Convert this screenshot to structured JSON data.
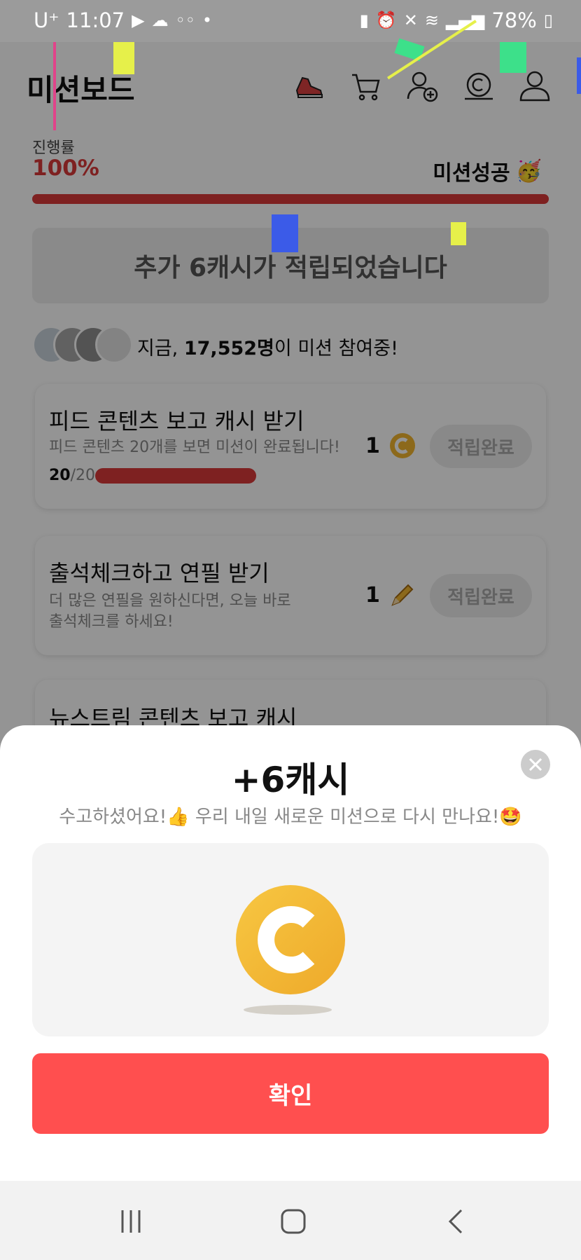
{
  "status_bar": {
    "carrier": "U⁺",
    "time": "11:07",
    "battery": "78%"
  },
  "header": {
    "title": "미션보드",
    "icons": [
      "shoe-icon",
      "cart-icon",
      "add-user-icon",
      "cash-icon",
      "profile-icon"
    ]
  },
  "progress": {
    "label": "진행률",
    "value_text": "100%",
    "value": 1.0,
    "status": "미션성공",
    "status_emoji": "🥳"
  },
  "notice": {
    "text": "추가 6캐시가 적립되었습니다"
  },
  "participants": {
    "prefix": "지금, ",
    "count": "17,552명",
    "suffix": "이 미션 참여중!"
  },
  "missions": [
    {
      "title": "피드 콘텐츠 보고 캐시 받기",
      "desc": "피드 콘텐츠 20개를 보면 미션이 완료됩니다!",
      "current": "20",
      "total": "/20",
      "progress": 1.0,
      "reward_amount": "1",
      "reward_icon": "coin-icon",
      "button": "적립완료"
    },
    {
      "title": "출석체크하고 연필 받기",
      "desc_line1": "더 많은 연필을 원하신다면, 오늘 바로",
      "desc_line2": "출석체크를 하세요!",
      "reward_amount": "1",
      "reward_icon": "pencil-icon",
      "button": "적립완료"
    },
    {
      "title": "뉴스트림 콘텐츠 보고 캐시"
    }
  ],
  "modal": {
    "title": "+6캐시",
    "message": "수고하셨어요!👍 우리 내일 새로운 미션으로 다시 만나요!🤩",
    "confirm": "확인",
    "close_icon": "close-icon"
  },
  "colors": {
    "accent_red": "#d93a3a",
    "confirm_red": "#ff4f4f",
    "coin_yellow": "#f2b630"
  },
  "nav": [
    "recent-apps-icon",
    "home-icon",
    "back-icon"
  ]
}
